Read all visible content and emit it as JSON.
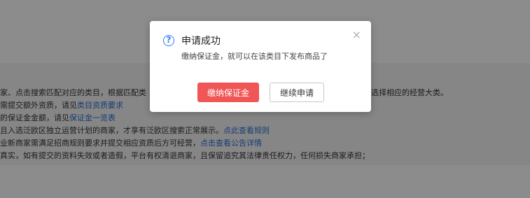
{
  "background": {
    "lines": [
      {
        "text": "家、点击搜索匹配对应的类目，根据匹配类",
        "right_text": "选择相应的经营大类。"
      },
      {
        "text": "需提交额外资质，请见",
        "link": "类目资质要求"
      },
      {
        "text": "的保证金金额，请见",
        "link": "保证金一览表"
      },
      {
        "text": "且入选泛欧区独立运营计划的商家，才享有泛欧区搜索正常展示。",
        "link": "点此查看规则"
      },
      {
        "text": "业新商家需满足招商规则要求并提交相应资质后方可经营，",
        "link": "点击查看公告详情"
      },
      {
        "text": "真实，如有提交的资料失效或者造假，平台有权清退商家，且保留追究其法律责任权力，任何损失商家承担；"
      }
    ]
  },
  "dialog": {
    "icon": "question-circle-icon",
    "title": "申请成功",
    "message": "缴纳保证金，就可以在该类目下发布商品了",
    "close_icon": "close-icon",
    "primary_button": "缴纳保证金",
    "secondary_button": "继续申请"
  },
  "colors": {
    "primary": "#f05656",
    "link": "#2d6fd6",
    "icon": "#2f7cf6"
  }
}
